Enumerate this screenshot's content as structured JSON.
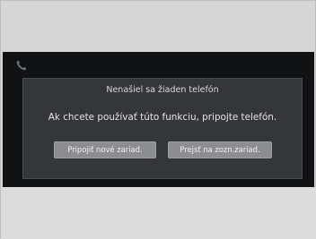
{
  "dialog": {
    "title": "Nenašiel sa žiaden telefón",
    "message": "Ak chcete používať túto funkciu, pripojte telefón.",
    "buttons": {
      "connect_new": "Pripojiť nové zariad.",
      "go_to_list": "Prejsť na zozn.zariad."
    }
  },
  "icons": {
    "status": "phone-icon"
  },
  "colors": {
    "screen_background": "#111214",
    "dialog_background": "#343639",
    "button_background": "#8c8d90",
    "bezel": "#d6d6d6"
  }
}
